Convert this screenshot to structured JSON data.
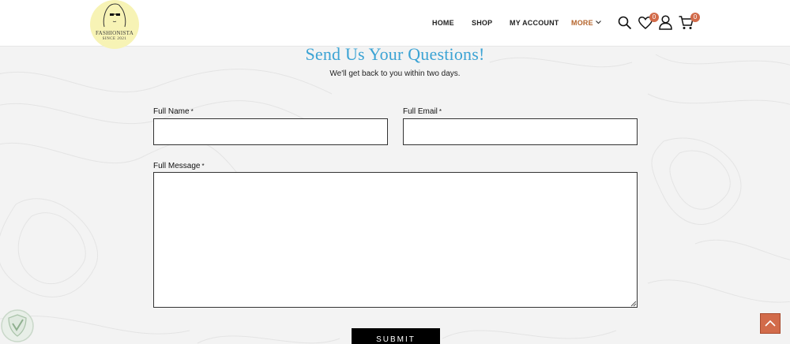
{
  "brand": {
    "name": "FASHIONISTA",
    "since": "SINCE 2021"
  },
  "nav": {
    "home": "HOME",
    "shop": "SHOP",
    "account": "MY ACCOUNT",
    "more": "MORE"
  },
  "header_icons": {
    "search": "search-icon",
    "wishlist": "heart-icon",
    "user": "user-icon",
    "cart": "cart-icon",
    "wishlist_count": "0",
    "cart_count": "0"
  },
  "form": {
    "title": "Send Us Your Questions!",
    "subtitle": "We'll get back to you within two days.",
    "name_label": "Full Name",
    "email_label": "Full Email",
    "message_label": "Full Message",
    "required_mark": "*",
    "name_value": "",
    "email_value": "",
    "message_value": "",
    "submit_label": "SUBMIT"
  },
  "colors": {
    "accent_title": "#3ba3d4",
    "badge": "#d26b4a",
    "nav_active": "#b5652c",
    "logo_bg": "#f7f3b5"
  },
  "widgets": {
    "scroll_top": "arrow-up-icon",
    "security_badge": "shield-icon"
  }
}
